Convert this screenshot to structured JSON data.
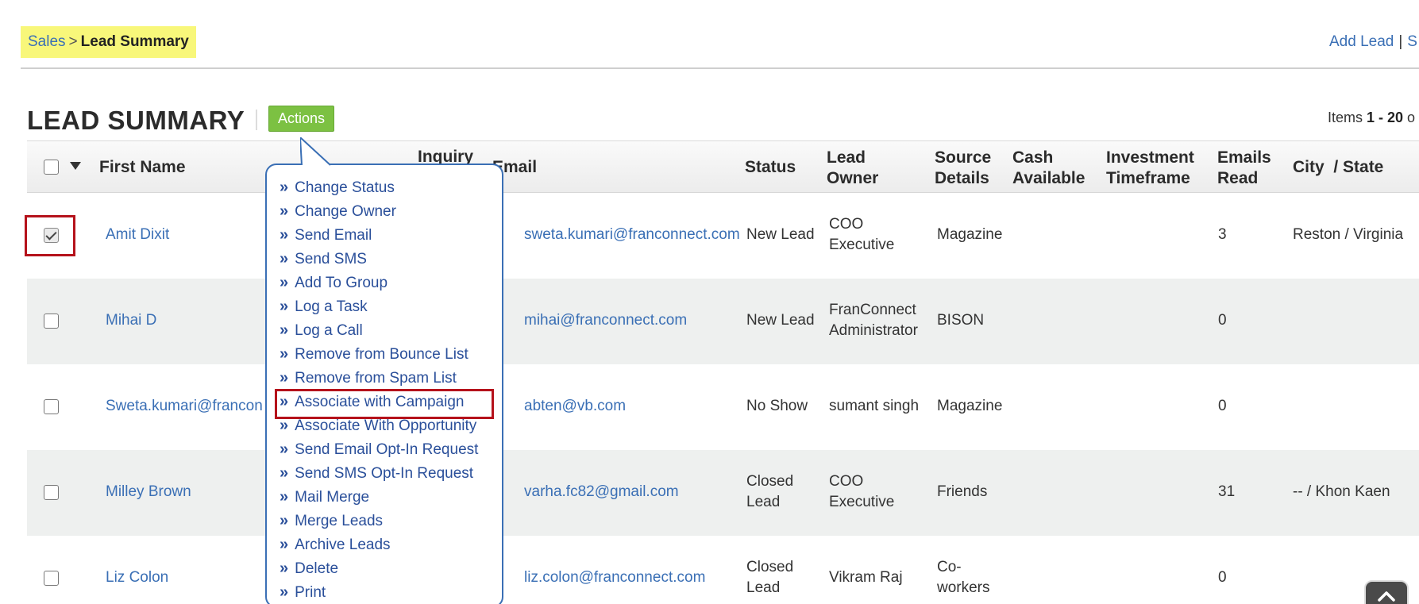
{
  "breadcrumb": {
    "parent": "Sales",
    "separator": ">",
    "current": "Lead Summary"
  },
  "top_links": {
    "add_lead": "Add  Lead",
    "pipe": "|",
    "next": "S"
  },
  "page": {
    "title": "LEAD SUMMARY",
    "actions_label": "Actions"
  },
  "items_info": {
    "prefix": "Items ",
    "range": "1 - 20",
    "suffix": " o"
  },
  "table": {
    "headers": {
      "first_name": "First Name",
      "inquiry": "Inquiry",
      "email": "Email",
      "status": "Status",
      "lead_owner": "Lead Owner",
      "source_details": "Source Details",
      "cash_available": "Cash Available",
      "investment_timeframe": "Investment Timeframe",
      "emails_read": "Emails Read",
      "city_state": "City  / State"
    },
    "rows": [
      {
        "checked": true,
        "first_name": "Amit Dixit",
        "email": "sweta.kumari@franconnect.com",
        "status": "New Lead",
        "lead_owner": "COO Executive",
        "source_details": "Magazine",
        "cash_available": "",
        "emails_read": "3",
        "city_state": "Reston / Virginia"
      },
      {
        "checked": false,
        "first_name": "Mihai D",
        "email": "mihai@franconnect.com",
        "status": "New Lead",
        "lead_owner": "FranConnect Administrator",
        "source_details": "BISON",
        "cash_available": "",
        "emails_read": "0",
        "city_state": ""
      },
      {
        "checked": false,
        "first_name": "Sweta.kumari@francon",
        "email": "abten@vb.com",
        "status": "No Show",
        "lead_owner": "sumant singh",
        "source_details": "Magazine",
        "cash_available": "",
        "emails_read": "0",
        "city_state": ""
      },
      {
        "checked": false,
        "first_name": "Milley Brown",
        "email": "varha.fc82@gmail.com",
        "status": "Closed Lead",
        "lead_owner": "COO Executive",
        "source_details": "Friends",
        "cash_available": "",
        "emails_read": "31",
        "city_state": "-- / Khon Kaen"
      },
      {
        "checked": false,
        "first_name": "Liz Colon",
        "email": "liz.colon@franconnect.com",
        "status": "Closed Lead",
        "lead_owner": "Vikram Raj",
        "source_details": "Co-workers",
        "cash_available": "",
        "emails_read": "0",
        "city_state": ""
      }
    ]
  },
  "actions_menu": {
    "bullet": "»",
    "items": [
      "Change Status",
      "Change Owner",
      "Send Email",
      "Send SMS",
      "Add To Group",
      "Log a Task",
      "Log a Call",
      "Remove from Bounce List",
      "Remove from Spam List",
      "Associate with Campaign",
      "Associate With Opportunity",
      "Send Email Opt-In Request",
      "Send SMS Opt-In Request",
      "Mail Merge",
      "Merge Leads",
      "Archive Leads",
      "Delete",
      "Print"
    ],
    "highlighted_item": "Associate with Campaign"
  },
  "icons": {
    "scroll_top": "chevron-up-icon",
    "select_caret": "caret-down-icon"
  },
  "colors": {
    "accent_green": "#7cc142",
    "link_blue": "#3a6fb5",
    "highlight_red": "#b5121b",
    "breadcrumb_bg": "#f8f77a"
  }
}
